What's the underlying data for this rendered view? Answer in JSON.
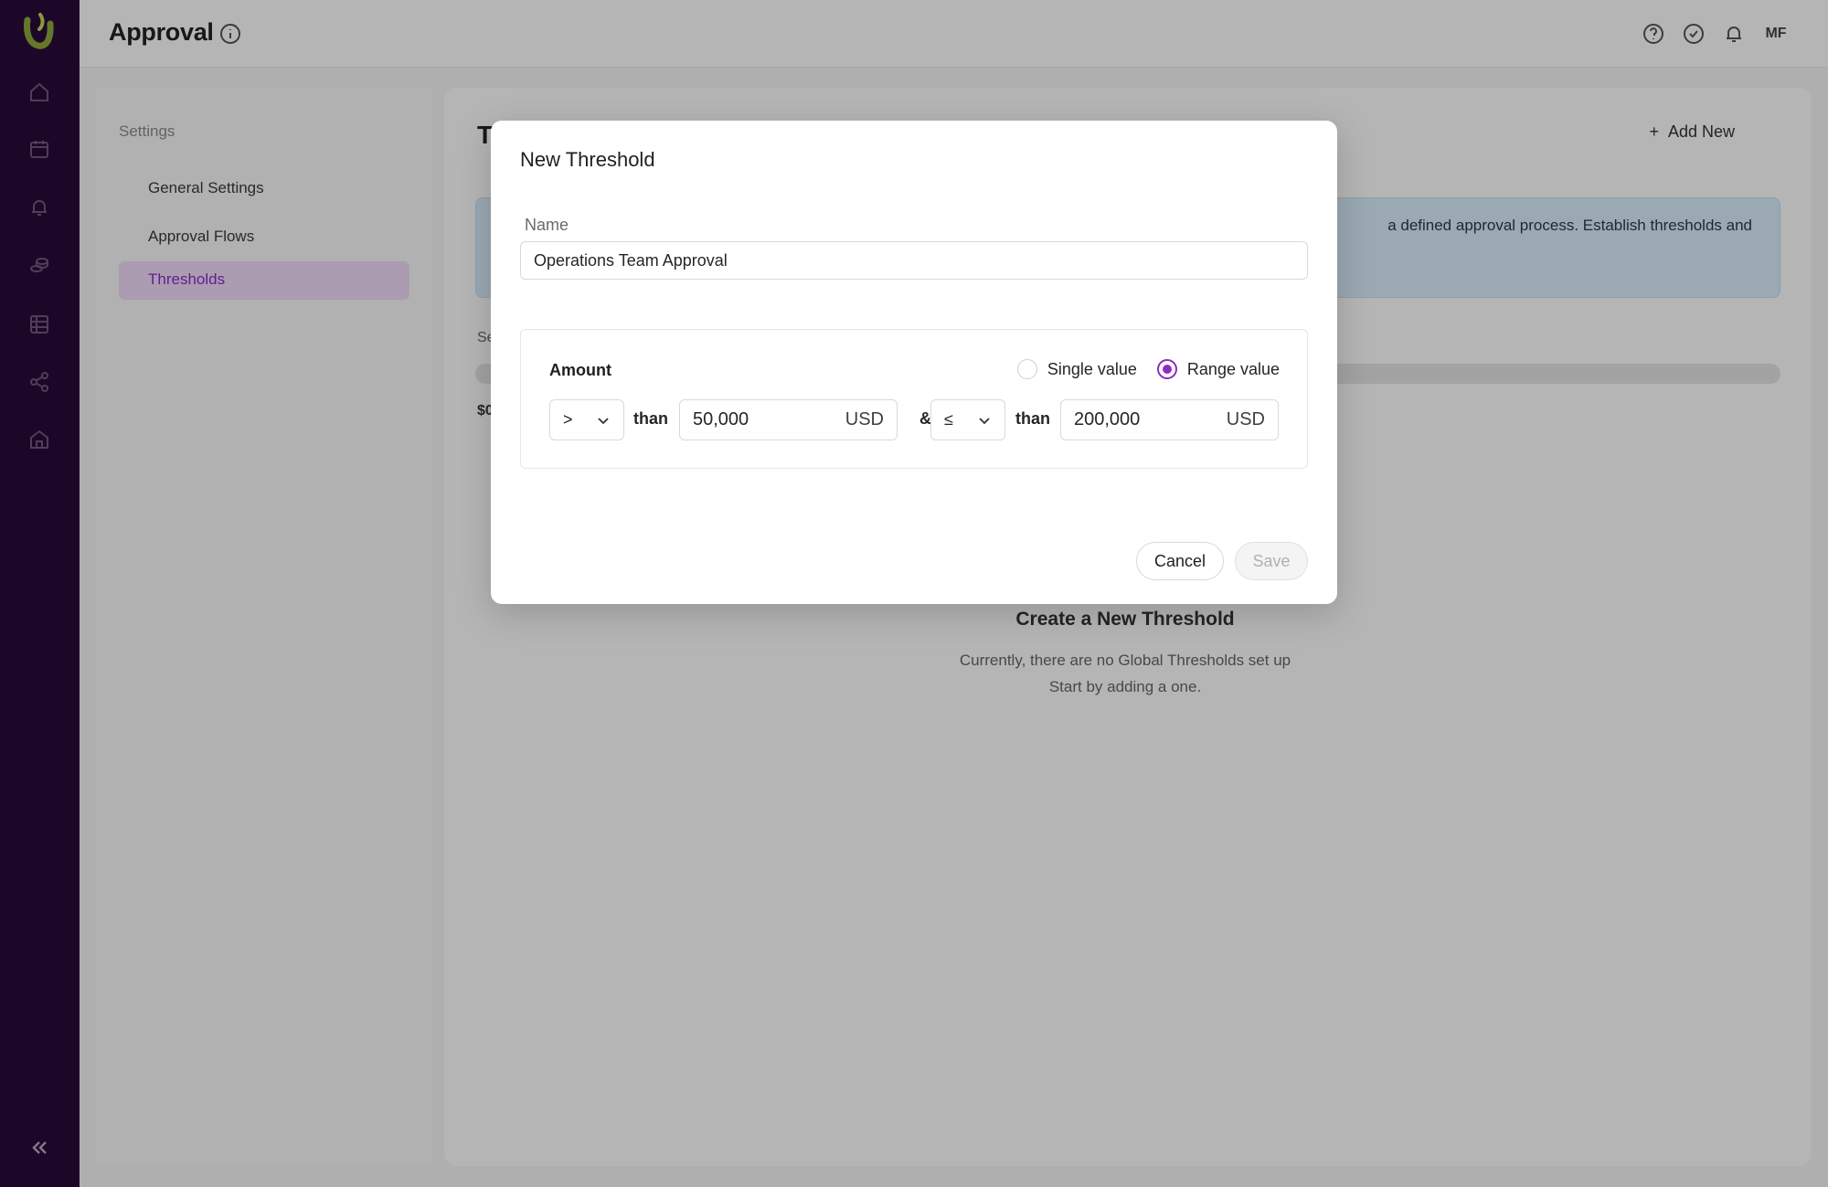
{
  "app": {
    "page_title": "Approval",
    "user_initials": "MF",
    "brand_color": "#2a0a3a",
    "accent_color": "#8e2bc7"
  },
  "rail": {
    "icons": [
      "home-icon",
      "calendar-icon",
      "bell-icon",
      "coins-icon",
      "table-icon",
      "share-icon",
      "bank-icon"
    ],
    "collapse_icon": "double-chevron-left-icon"
  },
  "header": {
    "icons": [
      "help-icon",
      "check-circle-icon",
      "bell-icon"
    ]
  },
  "settings_nav": {
    "heading": "Settings",
    "items": [
      {
        "label": "General Settings"
      },
      {
        "label": "Approval Flows"
      },
      {
        "label": "Thresholds",
        "active": true
      }
    ]
  },
  "main": {
    "title": "T",
    "add_new_label": "Add New",
    "banner_text": "a defined approval process. Establish thresholds and",
    "tabs_label": "Se",
    "small_tag": "$0",
    "empty_title": "Create a New Threshold",
    "empty_line1": "Currently, there are no Global Thresholds set up",
    "empty_line2": "Start by adding a one."
  },
  "modal": {
    "title": "New Threshold",
    "name_label": "Name",
    "name_value": "Operations Team Approval",
    "amount_label": "Amount",
    "radio_single": "Single value",
    "radio_range": "Range value",
    "selected_mode": "range",
    "cond1_operator": ">",
    "than_label": "than",
    "cond1_value": "50,000",
    "currency": "USD",
    "joiner": "&",
    "cond2_operator": "≤",
    "cond2_value": "200,000",
    "cancel_label": "Cancel",
    "save_label": "Save"
  }
}
